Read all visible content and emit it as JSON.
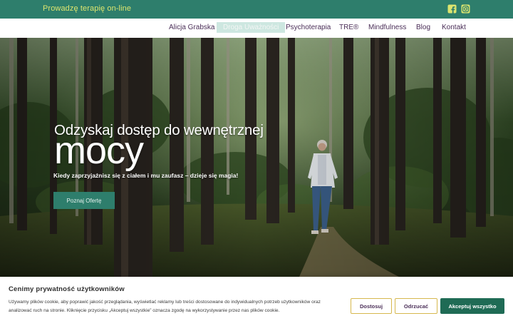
{
  "topbar": {
    "tagline": "Prowadzę terapię on-line",
    "social": [
      {
        "icon": "facebook-icon"
      },
      {
        "icon": "instagram-icon"
      }
    ],
    "background": "#2e7e6c",
    "text_color": "#dce56f"
  },
  "nav": {
    "items": [
      {
        "label": "Alicja Grabska"
      },
      {
        "label": "Droga Uważności",
        "active": true
      },
      {
        "label": "Psychoterapia"
      },
      {
        "label": "TRE®"
      },
      {
        "label": "Mindfulness"
      },
      {
        "label": "Blog"
      },
      {
        "label": "Kontakt"
      }
    ],
    "text_color": "#4b2f58",
    "active_background": "#cde7e0"
  },
  "hero": {
    "headline": "Odzyskaj dostęp do wewnętrznej",
    "headline_big": "mocy",
    "subtitle": "Kiedy zaprzyjaźnisz się z ciałem i mu zaufasz – dzieje się magia!",
    "button_label": "Poznaj Ofertę",
    "image": "forest-path-woman-walking"
  },
  "cookie_banner": {
    "title": "Cenimy prywatność użytkowników",
    "text": "Używamy plików cookie, aby poprawić jakość przeglądania, wyświetlać reklamy lub treści dostosowane do indywidualnych potrzeb użytkowników oraz analizować ruch na stronie. Kliknięcie przycisku „Akceptuj wszystkie” oznacza zgodę na wykorzystywanie przez nas plików cookie.",
    "buttons": {
      "customize": "Dostosuj",
      "reject": "Odrzucać",
      "accept": "Akceptuj wszystko"
    },
    "accept_color": "#1f6b55",
    "outline_color": "#d6b84e"
  }
}
